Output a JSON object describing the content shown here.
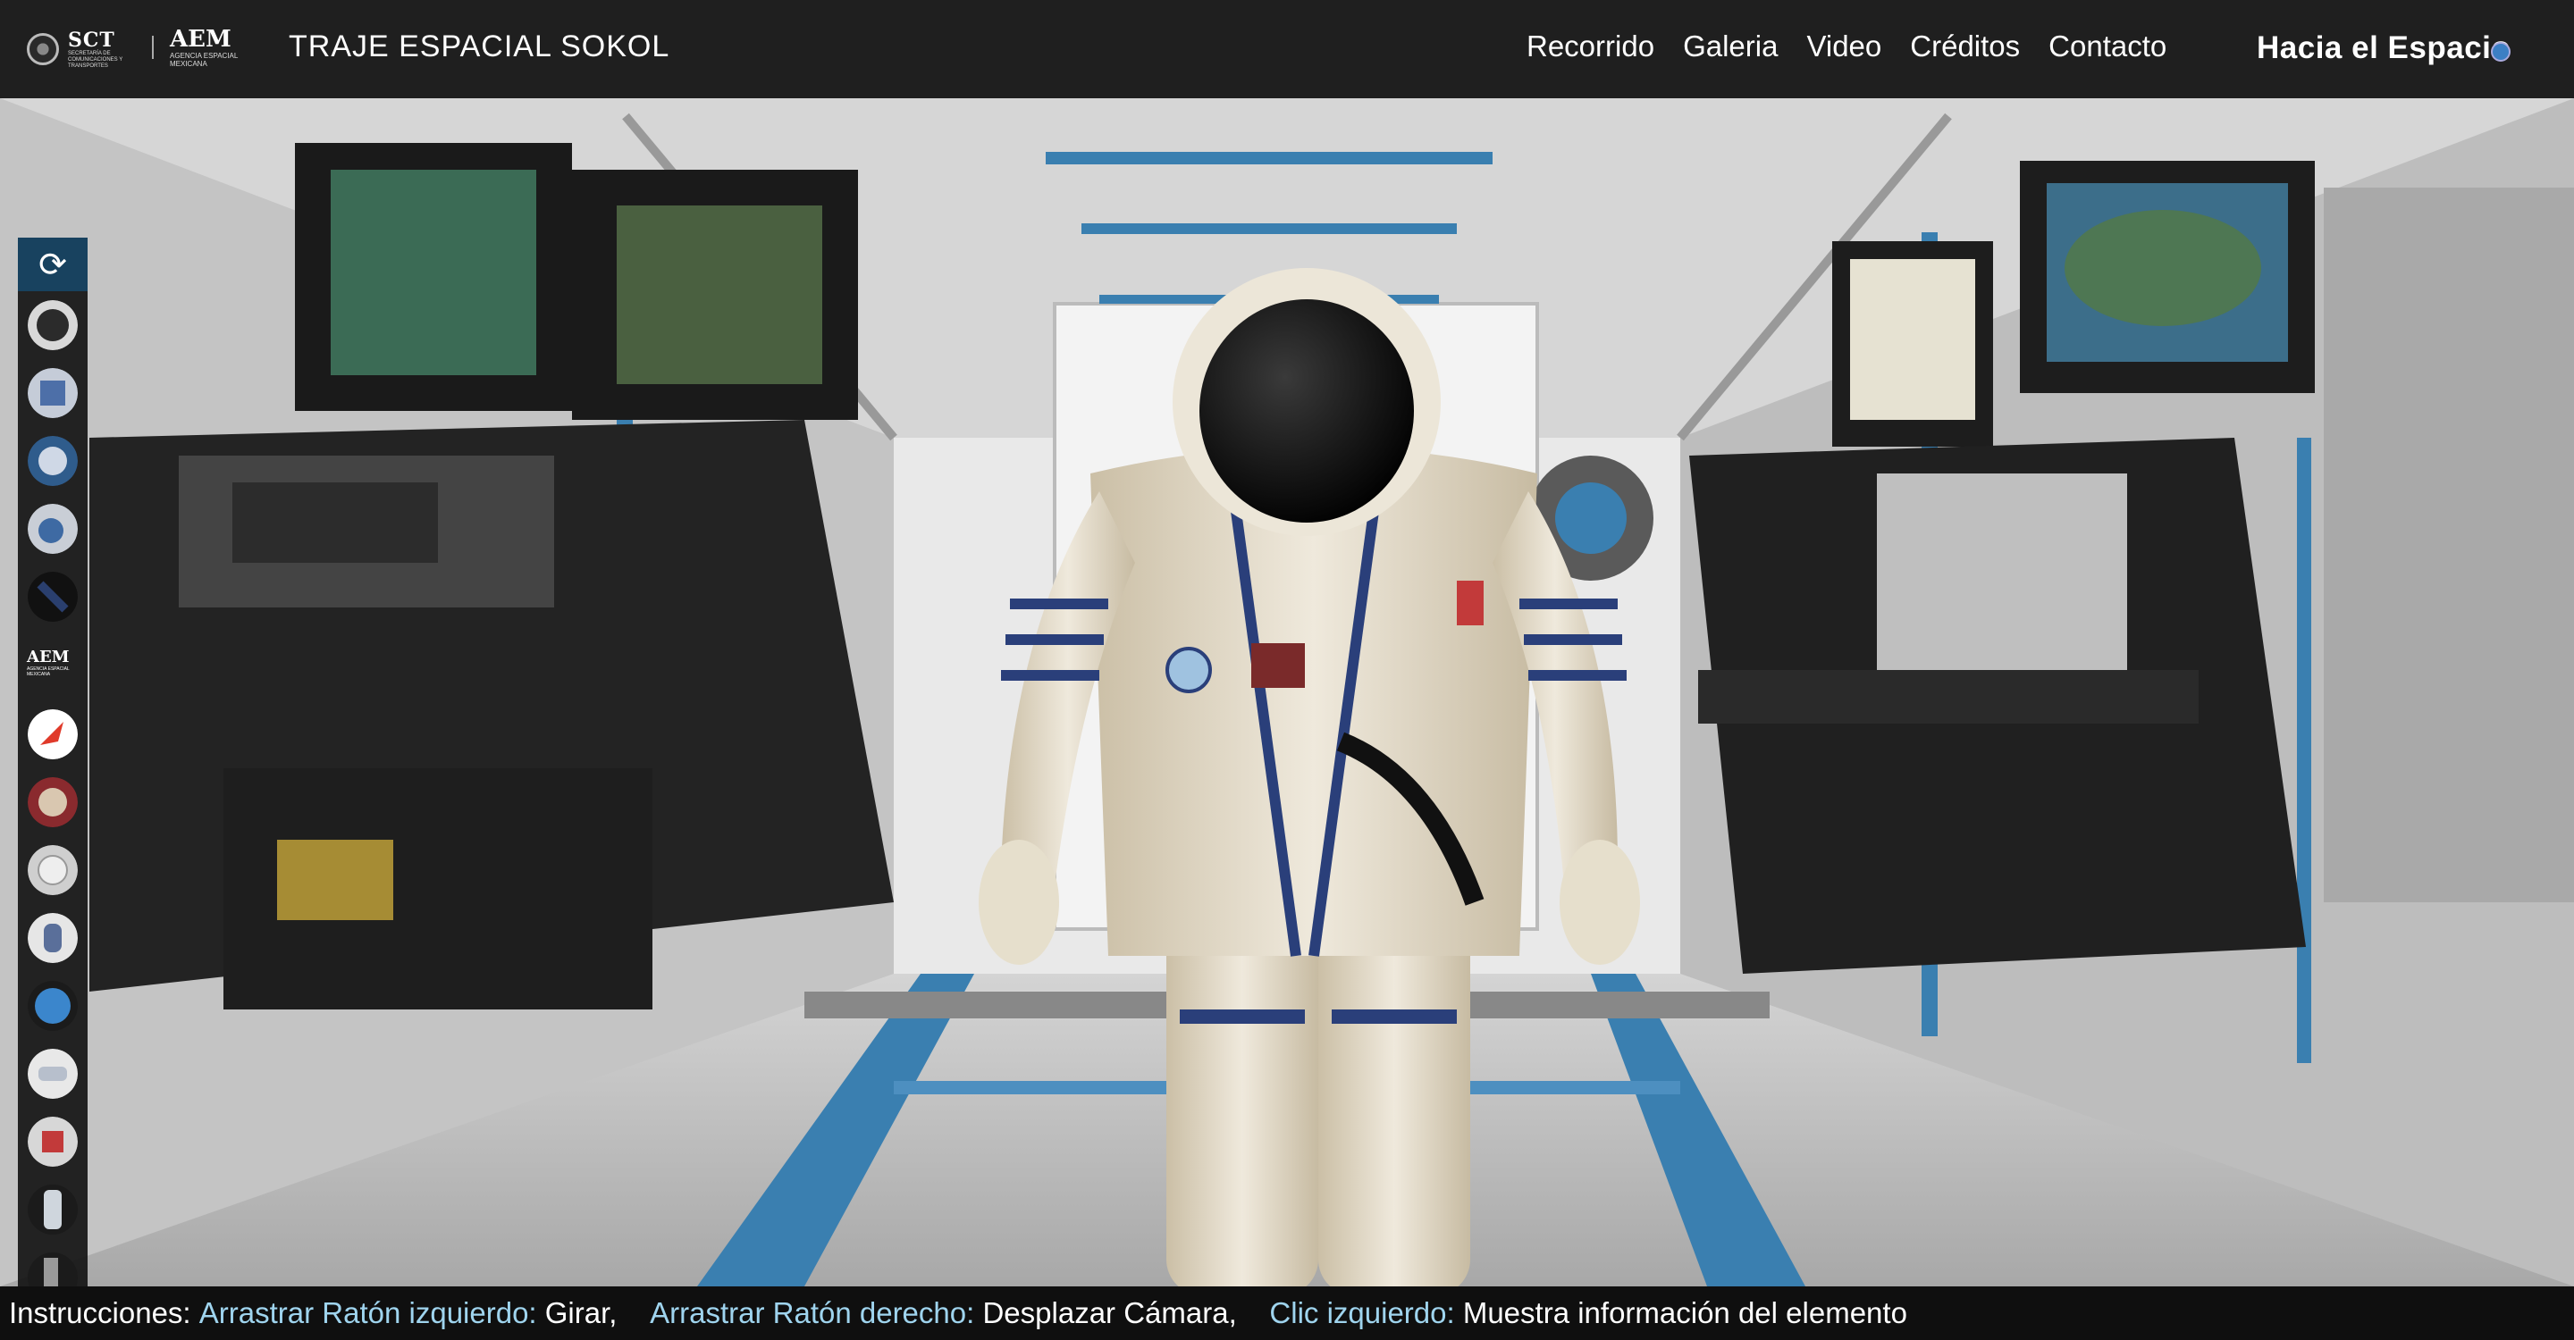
{
  "header": {
    "sct_name": "SCT",
    "sct_sub": "Secretaría de Comunicaciones y Transportes",
    "aem_name": "AEM",
    "aem_sub": "Agencia Espacial Mexicana",
    "title": "TRAJE ESPACIAL SOKOL",
    "nav": [
      "Recorrido",
      "Galeria",
      "Video",
      "Créditos",
      "Contacto"
    ],
    "brand": "Hacia el Espacio"
  },
  "sidebar": {
    "refresh_icon": "refresh-icon",
    "items": [
      {
        "name": "helmet-thumb",
        "color": "#2b2b2b"
      },
      {
        "name": "suit-chest-thumb",
        "color": "#4d6fa8"
      },
      {
        "name": "visor-thumb",
        "color": "#2f5c8c"
      },
      {
        "name": "valve-thumb",
        "color": "#3e6aa3"
      },
      {
        "name": "cable-thumb",
        "color": "#2a3f6e"
      },
      {
        "name": "aem-logo-thumb"
      },
      {
        "name": "roscosmos-thumb",
        "color": "#e03a2a"
      },
      {
        "name": "mission-patch-thumb",
        "color": "#8a2a2e"
      },
      {
        "name": "gauge-thumb",
        "color": "#cfcfcf"
      },
      {
        "name": "glove-thumb",
        "color": "#5a6f9a"
      },
      {
        "name": "blue-button-thumb",
        "color": "#3b86cc"
      },
      {
        "name": "arm-thumb",
        "color": "#b7bfcc"
      },
      {
        "name": "patch-thumb",
        "color": "#c23a3a"
      },
      {
        "name": "leg-thumb",
        "color": "#cfd6dd"
      },
      {
        "name": "boot-thumb",
        "color": "#9a9a9a"
      }
    ],
    "aem_label": "AEM",
    "aem_sub": "Agencia Espacial Mexicana"
  },
  "footer": {
    "prefix": "Instrucciones: ",
    "k1": "Arrastrar Ratón izquierdo:",
    "v1": " Girar,    ",
    "k2": "Arrastrar Ratón derecho:",
    "v2": " Desplazar Cámara,    ",
    "k3": "Clic izquierdo:",
    "v3": " Muestra información del elemento"
  },
  "colors": {
    "accent_blue": "#3a7fb0",
    "footer_key": "#9fd4ee",
    "refresh_bg": "#18425f"
  }
}
